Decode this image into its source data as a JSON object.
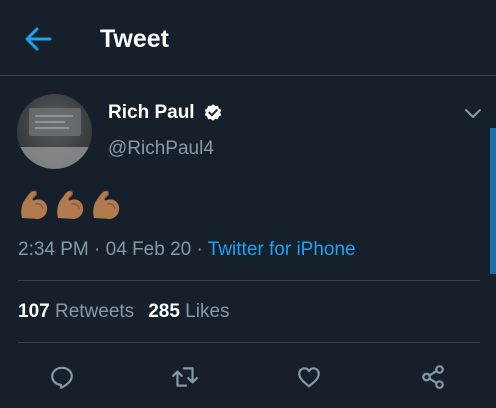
{
  "header": {
    "title": "Tweet",
    "back_icon": "arrow-left-icon"
  },
  "tweet": {
    "author": {
      "display_name": "Rich Paul",
      "handle": "@RichPaul4",
      "verified": true
    },
    "content_emoji": [
      "💪🏽",
      "💪🏽",
      "💪🏽"
    ],
    "time": "2:34 PM",
    "date": "04 Feb 20",
    "source": "Twitter for iPhone",
    "stats": {
      "retweets_count": "107",
      "retweets_label": "Retweets",
      "likes_count": "285",
      "likes_label": "Likes"
    }
  },
  "actions": [
    "reply-icon",
    "retweet-icon",
    "like-icon",
    "share-icon"
  ],
  "colors": {
    "background": "#15202b",
    "accent": "#1da1f2",
    "secondary_text": "#8899a6",
    "divider": "#38444d"
  }
}
